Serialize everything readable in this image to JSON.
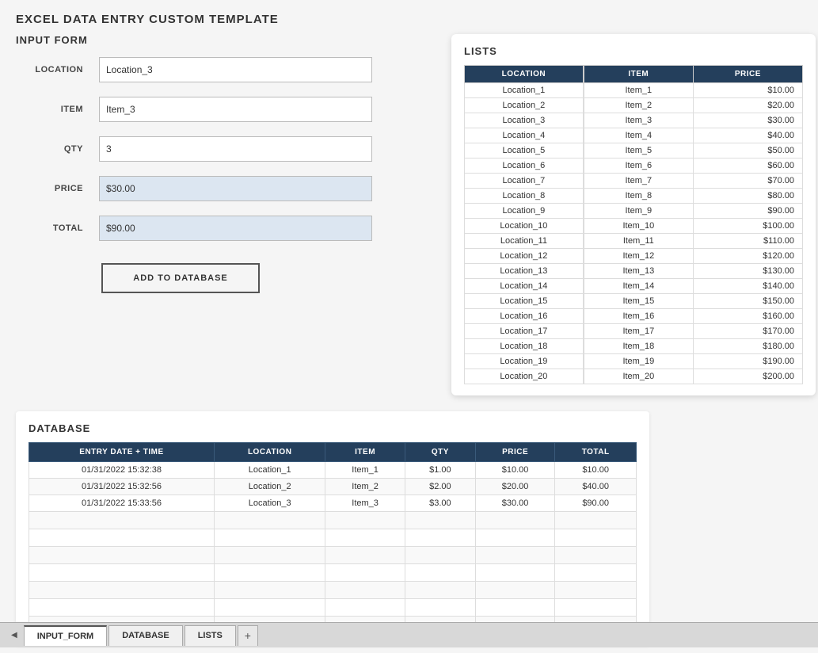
{
  "page": {
    "title": "EXCEL DATA ENTRY CUSTOM TEMPLATE"
  },
  "input_form": {
    "section_title": "INPUT FORM",
    "fields": {
      "location_label": "LOCATION",
      "location_value": "Location_3",
      "item_label": "ITEM",
      "item_value": "Item_3",
      "qty_label": "QTY",
      "qty_value": "3",
      "price_label": "PRICE",
      "price_value": "$30.00",
      "total_label": "TOTAL",
      "total_value": "$90.00"
    },
    "add_button_label": "ADD TO DATABASE"
  },
  "lists": {
    "title": "LISTS",
    "location_header": "LOCATION",
    "item_header": "ITEM",
    "price_header": "PRICE",
    "locations": [
      "Location_1",
      "Location_2",
      "Location_3",
      "Location_4",
      "Location_5",
      "Location_6",
      "Location_7",
      "Location_8",
      "Location_9",
      "Location_10",
      "Location_11",
      "Location_12",
      "Location_13",
      "Location_14",
      "Location_15",
      "Location_16",
      "Location_17",
      "Location_18",
      "Location_19",
      "Location_20"
    ],
    "items": [
      {
        "item": "Item_1",
        "price": "$10.00"
      },
      {
        "item": "Item_2",
        "price": "$20.00"
      },
      {
        "item": "Item_3",
        "price": "$30.00"
      },
      {
        "item": "Item_4",
        "price": "$40.00"
      },
      {
        "item": "Item_5",
        "price": "$50.00"
      },
      {
        "item": "Item_6",
        "price": "$60.00"
      },
      {
        "item": "Item_7",
        "price": "$70.00"
      },
      {
        "item": "Item_8",
        "price": "$80.00"
      },
      {
        "item": "Item_9",
        "price": "$90.00"
      },
      {
        "item": "Item_10",
        "price": "$100.00"
      },
      {
        "item": "Item_11",
        "price": "$110.00"
      },
      {
        "item": "Item_12",
        "price": "$120.00"
      },
      {
        "item": "Item_13",
        "price": "$130.00"
      },
      {
        "item": "Item_14",
        "price": "$140.00"
      },
      {
        "item": "Item_15",
        "price": "$150.00"
      },
      {
        "item": "Item_16",
        "price": "$160.00"
      },
      {
        "item": "Item_17",
        "price": "$170.00"
      },
      {
        "item": "Item_18",
        "price": "$180.00"
      },
      {
        "item": "Item_19",
        "price": "$190.00"
      },
      {
        "item": "Item_20",
        "price": "$200.00"
      }
    ]
  },
  "database": {
    "title": "DATABASE",
    "headers": [
      "ENTRY DATE + TIME",
      "LOCATION",
      "ITEM",
      "QTY",
      "PRICE",
      "TOTAL"
    ],
    "rows": [
      {
        "date": "01/31/2022 15:32:38",
        "location": "Location_1",
        "item": "Item_1",
        "qty": "$1.00",
        "price": "$10.00",
        "total": "$10.00"
      },
      {
        "date": "01/31/2022 15:32:56",
        "location": "Location_2",
        "item": "Item_2",
        "qty": "$2.00",
        "price": "$20.00",
        "total": "$40.00"
      },
      {
        "date": "01/31/2022 15:33:56",
        "location": "Location_3",
        "item": "Item_3",
        "qty": "$3.00",
        "price": "$30.00",
        "total": "$90.00"
      }
    ],
    "empty_rows": 7
  },
  "tabs": {
    "items": [
      "INPUT_FORM",
      "DATABASE",
      "LISTS"
    ],
    "active": "INPUT_FORM",
    "add_label": "+"
  }
}
